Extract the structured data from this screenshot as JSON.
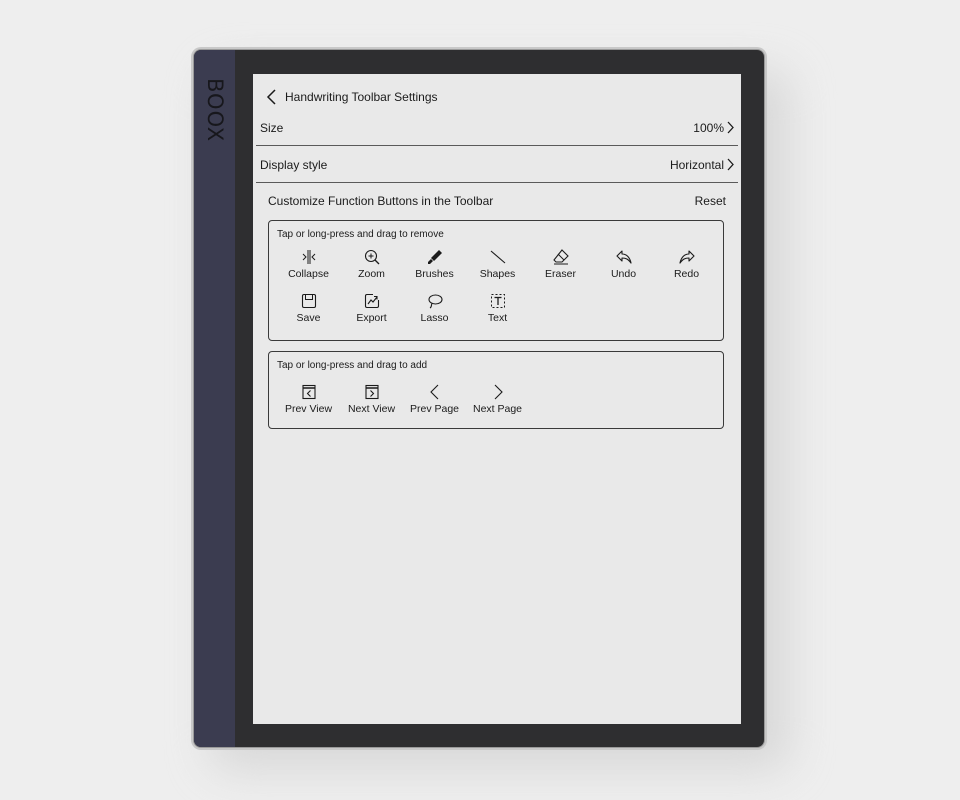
{
  "device": {
    "brand": "BOOX"
  },
  "header": {
    "back_icon": "chevron-left-icon",
    "title": "Handwriting Toolbar Settings"
  },
  "settings": {
    "size": {
      "label": "Size",
      "value": "100%"
    },
    "display_style": {
      "label": "Display style",
      "value": "Horizontal"
    }
  },
  "customize": {
    "title": "Customize Function Buttons in the Toolbar",
    "reset_label": "Reset"
  },
  "remove_section": {
    "hint": "Tap or long-press and drag to remove",
    "buttons": [
      {
        "label": "Collapse",
        "icon": "collapse-icon"
      },
      {
        "label": "Zoom",
        "icon": "zoom-icon"
      },
      {
        "label": "Brushes",
        "icon": "brush-icon"
      },
      {
        "label": "Shapes",
        "icon": "shapes-icon"
      },
      {
        "label": "Eraser",
        "icon": "eraser-icon"
      },
      {
        "label": "Undo",
        "icon": "undo-icon"
      },
      {
        "label": "Redo",
        "icon": "redo-icon"
      },
      {
        "label": "Save",
        "icon": "save-icon"
      },
      {
        "label": "Export",
        "icon": "export-icon"
      },
      {
        "label": "Lasso",
        "icon": "lasso-icon"
      },
      {
        "label": "Text",
        "icon": "text-icon"
      }
    ]
  },
  "add_section": {
    "hint": "Tap or long-press and drag to add",
    "buttons": [
      {
        "label": "Prev View",
        "icon": "prev-view-icon"
      },
      {
        "label": "Next View",
        "icon": "next-view-icon"
      },
      {
        "label": "Prev Page",
        "icon": "prev-page-icon"
      },
      {
        "label": "Next Page",
        "icon": "next-page-icon"
      }
    ]
  }
}
